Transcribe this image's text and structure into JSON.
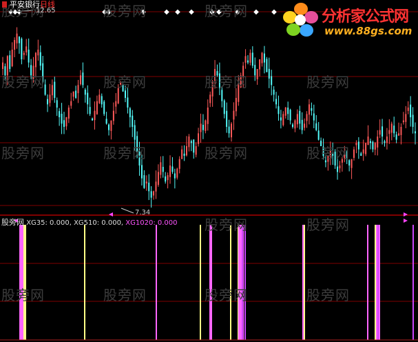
{
  "header": {
    "stock_name": "平安银行",
    "period": "日线",
    "high_label": "12.65",
    "low_label": "7.34"
  },
  "indicator": {
    "name": "股旁网",
    "xg35": "XG35: 0.000,",
    "xg510": "XG510: 0.000,",
    "xg1020": "XG1020: 0.000"
  },
  "logo": {
    "title": "分析家公式网",
    "url": "www.88gs.com"
  },
  "watermark": "股旁网",
  "colors": {
    "up": "#ff5a5a",
    "down": "#54fcfc",
    "grid": "#800000",
    "xg35": "#ffff88",
    "xg510": "#ff66ff",
    "xg1020": "#cc44ff"
  },
  "chart_data": [
    {
      "type": "candlestick",
      "series_name": "平安银行 日线",
      "ylim": [
        6.9,
        13.2
      ],
      "marked_high": 12.65,
      "marked_low": 7.34,
      "close": [
        11.6,
        11.2,
        11.8,
        11.4,
        12.0,
        12.3,
        12.5,
        12.2,
        11.7,
        11.9,
        12.1,
        11.6,
        11.2,
        11.5,
        11.9,
        12.0,
        11.5,
        11.0,
        10.6,
        10.3,
        10.6,
        10.9,
        10.5,
        10.2,
        9.9,
        9.7,
        9.6,
        9.9,
        10.2,
        10.4,
        10.7,
        10.5,
        10.9,
        11.2,
        10.9,
        10.6,
        10.3,
        10.0,
        9.8,
        10.1,
        10.4,
        10.6,
        10.3,
        10.0,
        9.7,
        9.5,
        9.8,
        10.1,
        10.4,
        10.8,
        11.0,
        10.7,
        10.5,
        10.2,
        9.9,
        9.6,
        9.2,
        8.8,
        8.4,
        8.0,
        7.7,
        7.9,
        7.6,
        7.4,
        7.6,
        7.9,
        8.2,
        8.5,
        8.2,
        7.9,
        8.1,
        8.4,
        8.2,
        8.0,
        8.3,
        8.6,
        8.9,
        8.7,
        9.0,
        9.3,
        9.1,
        8.8,
        9.0,
        9.4,
        9.7,
        9.5,
        9.8,
        10.2,
        10.6,
        11.0,
        11.4,
        11.2,
        10.8,
        10.4,
        10.0,
        9.6,
        9.4,
        9.7,
        10.1,
        10.5,
        10.9,
        11.2,
        11.5,
        11.8,
        11.6,
        11.9,
        11.5,
        11.2,
        11.4,
        11.7,
        11.9,
        11.6,
        11.3,
        11.1,
        10.9,
        10.6,
        10.3,
        10.0,
        9.8,
        10.0,
        10.2,
        10.0,
        9.8,
        9.6,
        9.8,
        10.0,
        9.7,
        9.5,
        9.7,
        10.0,
        10.3,
        10.1,
        9.8,
        9.5,
        9.2,
        9.0,
        8.7,
        8.5,
        8.7,
        8.9,
        8.7,
        8.4,
        8.2,
        8.4,
        8.6,
        8.8,
        8.6,
        8.4,
        8.6,
        8.9,
        9.1,
        8.9,
        8.7,
        8.9,
        9.1,
        9.3,
        9.1,
        8.9,
        9.1,
        9.3,
        9.5,
        9.3,
        9.1,
        9.3,
        9.5,
        9.7,
        9.4,
        9.2,
        9.4,
        9.6,
        9.8,
        10.0,
        10.2,
        9.9,
        9.6,
        9.4
      ]
    },
    {
      "type": "signal_bars",
      "series": [
        {
          "name": "XG35",
          "positions": [
            33,
            35,
            37,
            123,
            227,
            291,
            335,
            346,
            442,
            545,
            549
          ]
        },
        {
          "name": "XG510",
          "positions": [
            29,
            31,
            33,
            227,
            305,
            307,
            347,
            349,
            351,
            353,
            440,
            534,
            547,
            549,
            551
          ]
        },
        {
          "name": "XG1020",
          "positions": [
            352,
            356,
            549,
            600
          ]
        }
      ]
    }
  ]
}
